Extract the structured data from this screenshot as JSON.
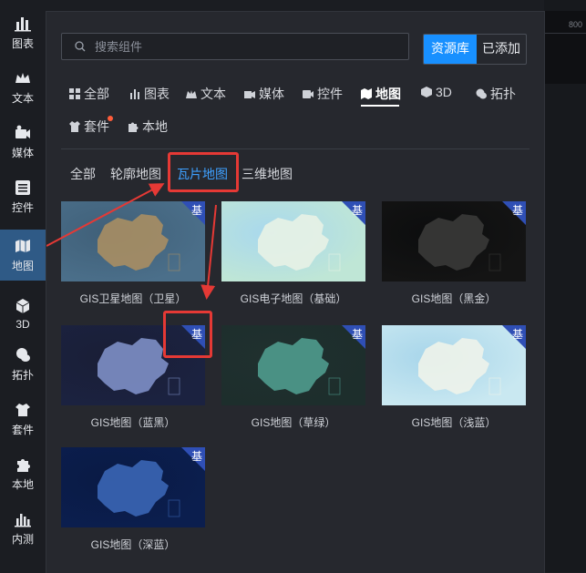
{
  "rail": [
    {
      "label": "图表",
      "icon": "bar-chart-icon"
    },
    {
      "label": "文本",
      "icon": "crown-icon"
    },
    {
      "label": "媒体",
      "icon": "camera-icon"
    },
    {
      "label": "控件",
      "icon": "list-icon"
    },
    {
      "label": "地图",
      "icon": "map-icon"
    },
    {
      "label": "3D",
      "icon": "cube-icon"
    },
    {
      "label": "拓扑",
      "icon": "topology-icon"
    },
    {
      "label": "套件",
      "icon": "shirt-icon"
    },
    {
      "label": "本地",
      "icon": "puzzle-icon"
    },
    {
      "label": "内测",
      "icon": "chart-beta-icon"
    }
  ],
  "search": {
    "placeholder": "搜索组件"
  },
  "segment": {
    "primary": "资源库",
    "secondary": "已添加"
  },
  "tabs": [
    {
      "label": "全部"
    },
    {
      "label": "图表"
    },
    {
      "label": "文本"
    },
    {
      "label": "媒体"
    },
    {
      "label": "控件"
    },
    {
      "label": "地图"
    },
    {
      "label": "3D"
    },
    {
      "label": "拓扑"
    },
    {
      "label": "套件"
    },
    {
      "label": "本地"
    }
  ],
  "subtabs": [
    {
      "label": "全部"
    },
    {
      "label": "轮廓地图"
    },
    {
      "label": "瓦片地图"
    },
    {
      "label": "三维地图"
    }
  ],
  "badge": "基",
  "ruler": "800",
  "cards": [
    {
      "title": "GIS卫星地图（卫星）",
      "colors": [
        "#4b6f8a",
        "#a98e63",
        "#3f5f78"
      ]
    },
    {
      "title": "GIS电子地图（基础）",
      "colors": [
        "#bfe6d6",
        "#e8f2e6",
        "#a8d8ee"
      ]
    },
    {
      "title": "GIS地图（黑金）",
      "colors": [
        "#141414",
        "#3a3a38",
        "#0c0d0e"
      ]
    },
    {
      "title": "GIS地图（蓝黑）",
      "colors": [
        "#1b2240",
        "#7e8fc6",
        "#1a1e36"
      ]
    },
    {
      "title": "GIS地图（草绿）",
      "colors": [
        "#1d2e2c",
        "#4f9c8e",
        "#20302f"
      ]
    },
    {
      "title": "GIS地图（浅蓝）",
      "colors": [
        "#c9e8f1",
        "#eef3ea",
        "#a7d5ea"
      ]
    },
    {
      "title": "GIS地图（深蓝）",
      "colors": [
        "#0b1e4e",
        "#3a66b5",
        "#0a1a44"
      ]
    }
  ]
}
